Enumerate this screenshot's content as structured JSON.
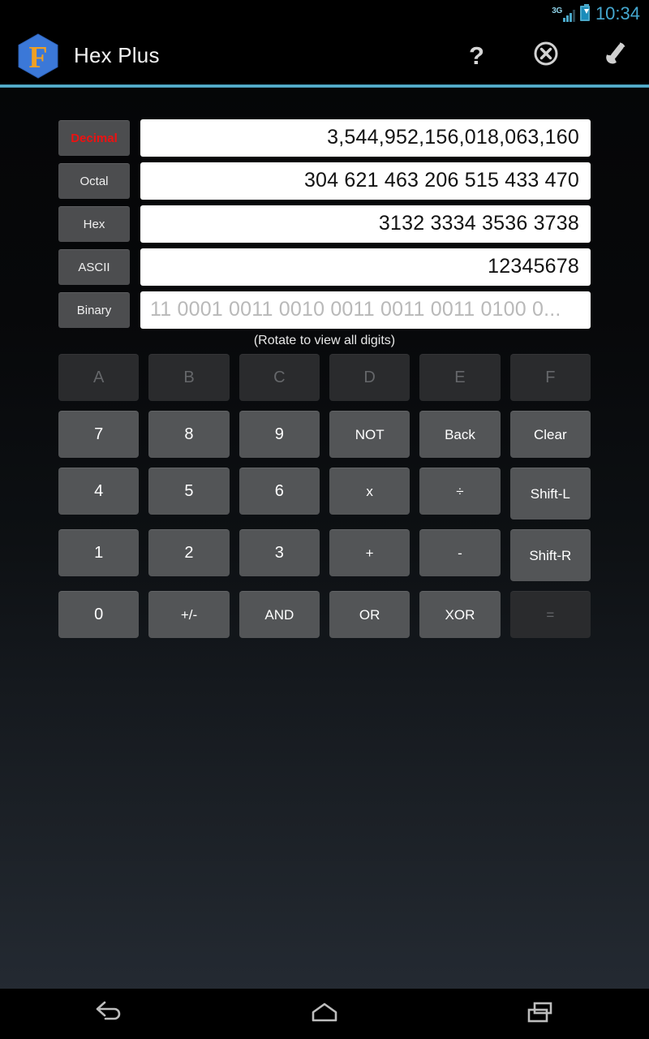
{
  "statusbar": {
    "network": "3G",
    "time": "10:34",
    "battery_icon": "battery-charging-icon",
    "signal_icon": "signal-bars-icon"
  },
  "actionbar": {
    "app_icon": "hexagon-f-logo",
    "title": "Hex Plus",
    "actions": [
      {
        "name": "help-button",
        "icon": "question-mark-icon",
        "label": "?"
      },
      {
        "name": "close-button",
        "icon": "circle-x-icon",
        "label": ""
      },
      {
        "name": "settings-button",
        "icon": "wrench-icon",
        "label": ""
      }
    ],
    "accent_color": "#63bcd8"
  },
  "fields": [
    {
      "label": "Decimal",
      "value": "3,544,952,156,018,063,160",
      "accent": true,
      "muted": false
    },
    {
      "label": "Octal",
      "value": "304 621 463 206 515 433 470",
      "accent": false,
      "muted": false
    },
    {
      "label": "Hex",
      "value": "3132 3334 3536 3738",
      "accent": false,
      "muted": false
    },
    {
      "label": "ASCII",
      "value": "12345678",
      "accent": false,
      "muted": false
    },
    {
      "label": "Binary",
      "value": "11 0001 0011 0010 0011 0011 0011 0100 0...",
      "accent": false,
      "muted": true
    }
  ],
  "hint": "(Rotate to view all digits)",
  "keypad": {
    "rows": [
      [
        {
          "label": "A",
          "disabled": true,
          "size": "normal"
        },
        {
          "label": "B",
          "disabled": true,
          "size": "normal"
        },
        {
          "label": "C",
          "disabled": true,
          "size": "normal"
        },
        {
          "label": "D",
          "disabled": true,
          "size": "normal"
        },
        {
          "label": "E",
          "disabled": true,
          "size": "normal"
        },
        {
          "label": "F",
          "disabled": true,
          "size": "normal"
        }
      ],
      [
        {
          "label": "7",
          "disabled": false,
          "size": "normal"
        },
        {
          "label": "8",
          "disabled": false,
          "size": "normal"
        },
        {
          "label": "9",
          "disabled": false,
          "size": "normal"
        },
        {
          "label": "NOT",
          "disabled": false,
          "size": "small"
        },
        {
          "label": "Back",
          "disabled": false,
          "size": "small"
        },
        {
          "label": "Clear",
          "disabled": false,
          "size": "small"
        }
      ],
      [
        {
          "label": "4",
          "disabled": false,
          "size": "normal"
        },
        {
          "label": "5",
          "disabled": false,
          "size": "normal"
        },
        {
          "label": "6",
          "disabled": false,
          "size": "normal"
        },
        {
          "label": "x",
          "disabled": false,
          "size": "small"
        },
        {
          "label": "÷",
          "disabled": false,
          "size": "small"
        },
        {
          "label": "Shift-L",
          "disabled": false,
          "size": "tall"
        }
      ],
      [
        {
          "label": "1",
          "disabled": false,
          "size": "normal"
        },
        {
          "label": "2",
          "disabled": false,
          "size": "normal"
        },
        {
          "label": "3",
          "disabled": false,
          "size": "normal"
        },
        {
          "label": "+",
          "disabled": false,
          "size": "small"
        },
        {
          "label": "-",
          "disabled": false,
          "size": "small"
        },
        {
          "label": "Shift-R",
          "disabled": false,
          "size": "tall"
        }
      ],
      [
        {
          "label": "0",
          "disabled": false,
          "size": "normal"
        },
        {
          "label": "+/-",
          "disabled": false,
          "size": "small"
        },
        {
          "label": "AND",
          "disabled": false,
          "size": "small"
        },
        {
          "label": "OR",
          "disabled": false,
          "size": "small"
        },
        {
          "label": "XOR",
          "disabled": false,
          "size": "small"
        },
        {
          "label": "=",
          "disabled": true,
          "size": "small"
        }
      ]
    ]
  },
  "navbar": [
    {
      "name": "nav-back-button",
      "icon": "back-arrow-icon"
    },
    {
      "name": "nav-home-button",
      "icon": "home-icon"
    },
    {
      "name": "nav-recents-button",
      "icon": "recent-apps-icon"
    }
  ]
}
